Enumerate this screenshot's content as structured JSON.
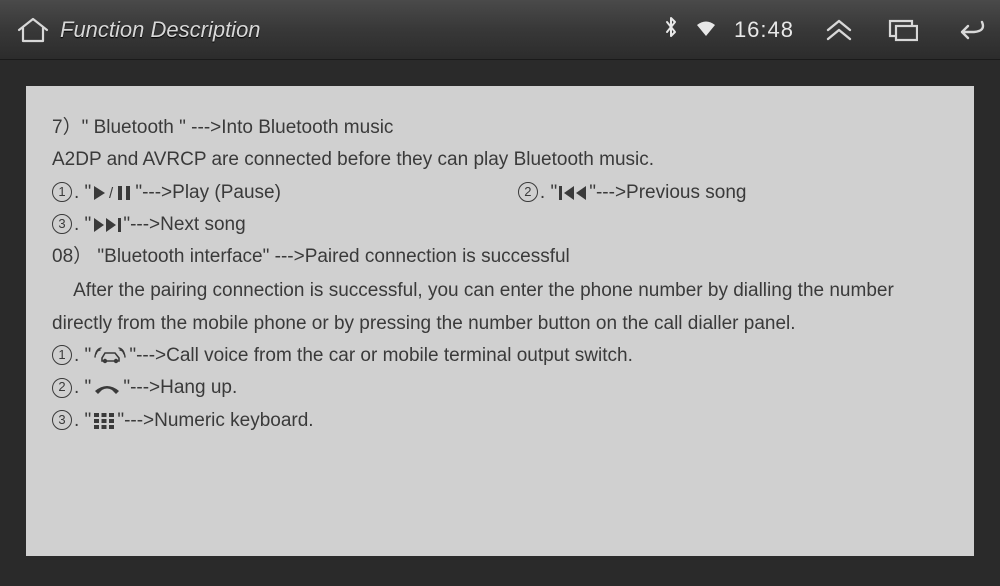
{
  "statusbar": {
    "title": "Function Description",
    "time": "16:48"
  },
  "content": {
    "line1_prefix": "7）\"  Bluetooth  \"  --->",
    "line1_suffix": " Into Bluetooth music",
    "line2": " A2DP and AVRCP are connected before they can play Bluetooth music.",
    "item1": {
      "num": "1",
      "label": " --->Play (Pause)"
    },
    "item2": {
      "num": "2",
      "label": " --->Previous song"
    },
    "item3": {
      "num": "3",
      "label": " --->Next song"
    },
    "line8": "08）  \"Bluetooth interface\"  --->Paired connection is successful",
    "para": "    After the pairing connection is successful, you can enter the phone number by dialling the number directly from the mobile phone or by pressing the number button on the call dialler panel.",
    "item4": {
      "num": "1",
      "label": " --->Call voice from the car or mobile terminal output switch."
    },
    "item5": {
      "num": "2",
      "label": " --->Hang up."
    },
    "item6": {
      "num": "3",
      "label": " --->Numeric keyboard."
    },
    "quote_open": ". \"",
    "quote_close": "\" "
  }
}
